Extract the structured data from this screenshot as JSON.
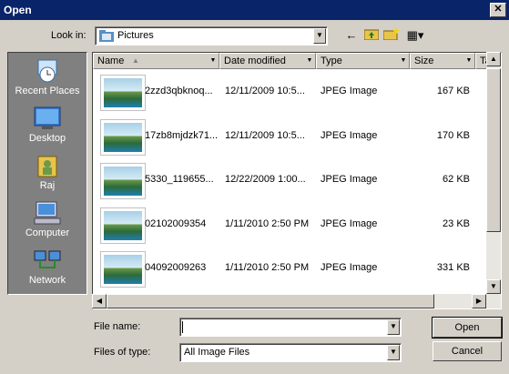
{
  "window": {
    "title": "Open",
    "close": "✕"
  },
  "lookin": {
    "label": "Look in:",
    "value": "Pictures"
  },
  "toolbar": {
    "back": "←",
    "up": "⤴",
    "new_folder": "✱",
    "views": "▦▾"
  },
  "places": [
    {
      "label": "Recent Places",
      "icon": "recent-places-icon"
    },
    {
      "label": "Desktop",
      "icon": "desktop-icon"
    },
    {
      "label": "Raj",
      "icon": "user-folder-icon"
    },
    {
      "label": "Computer",
      "icon": "computer-icon"
    },
    {
      "label": "Network",
      "icon": "network-icon"
    }
  ],
  "columns": [
    "Name",
    "Date modified",
    "Type",
    "Size",
    "Ta"
  ],
  "files": [
    {
      "name": "2zzd3qbknoq...",
      "date": "12/11/2009 10:5...",
      "type": "JPEG Image",
      "size": "167 KB"
    },
    {
      "name": "17zb8mjdzk71...",
      "date": "12/11/2009 10:5...",
      "type": "JPEG Image",
      "size": "170 KB"
    },
    {
      "name": "5330_119655...",
      "date": "12/22/2009 1:00...",
      "type": "JPEG Image",
      "size": "62 KB"
    },
    {
      "name": "02102009354",
      "date": "1/11/2010 2:50 PM",
      "type": "JPEG Image",
      "size": "23 KB"
    },
    {
      "name": "04092009263",
      "date": "1/11/2010 2:50 PM",
      "type": "JPEG Image",
      "size": "331 KB"
    }
  ],
  "filename": {
    "label": "File name:",
    "value": ""
  },
  "filetype": {
    "label": "Files of type:",
    "value": "All Image Files"
  },
  "buttons": {
    "open": "Open",
    "cancel": "Cancel"
  }
}
